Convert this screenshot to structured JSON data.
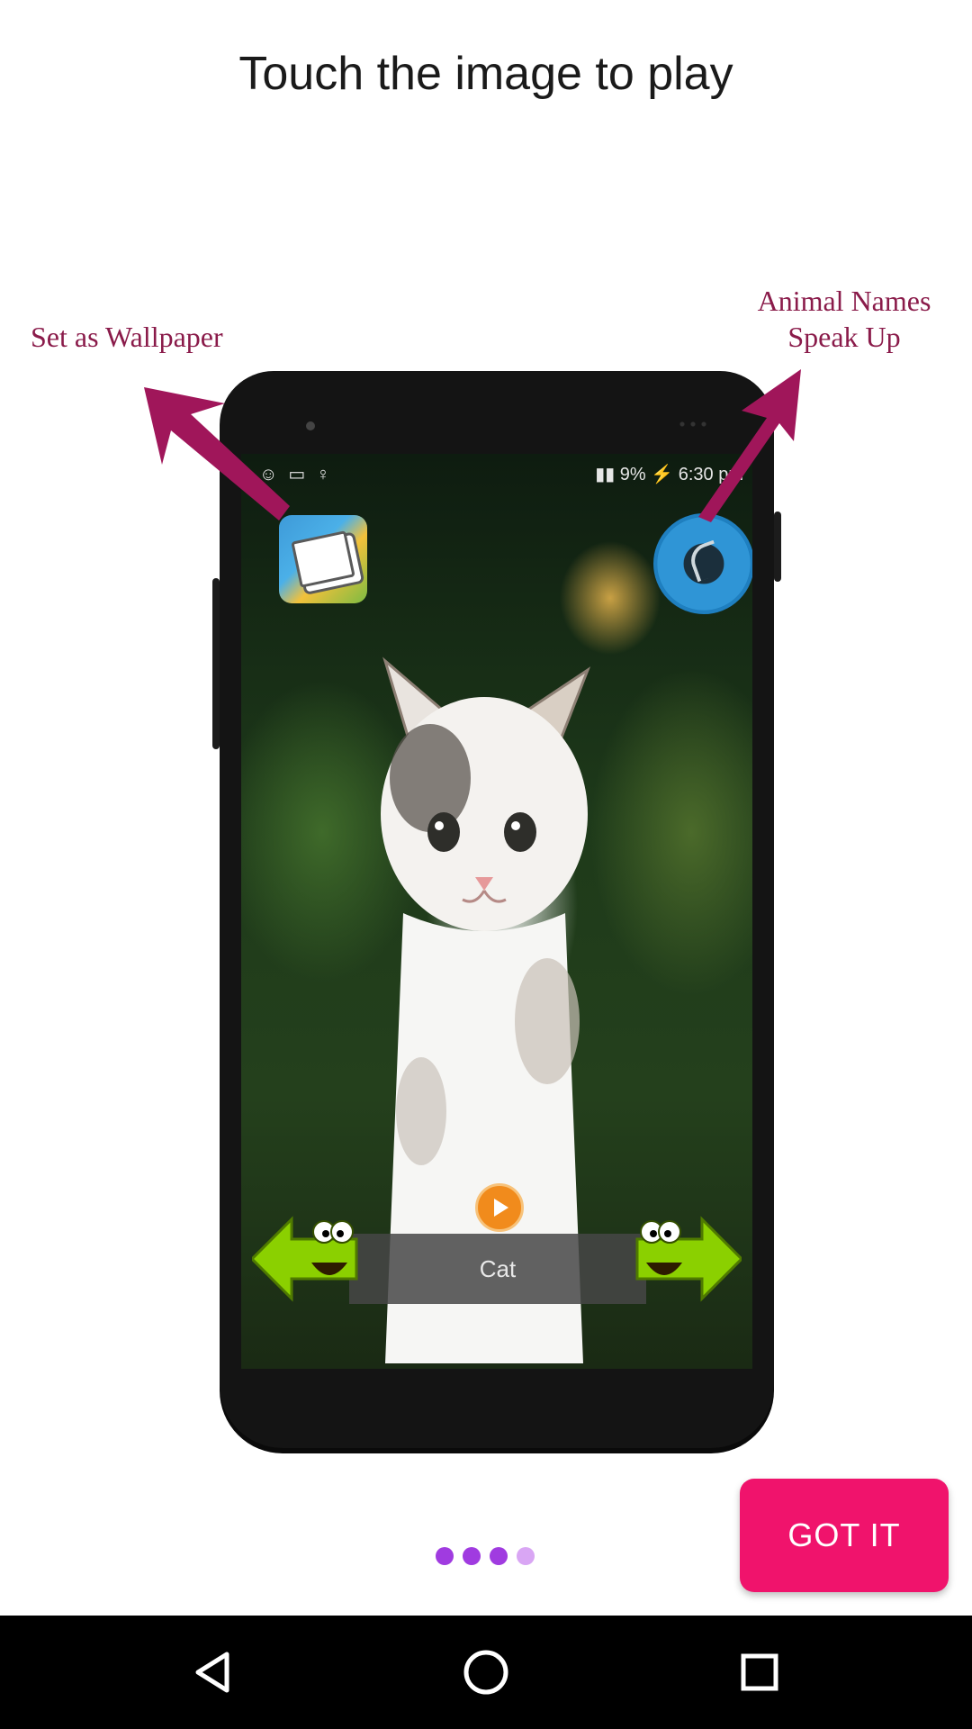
{
  "header": {
    "title": "Touch the image to play"
  },
  "callouts": {
    "left": "Set as Wallpaper",
    "right_line1": "Animal Names",
    "right_line2": "Speak Up"
  },
  "phone_screen": {
    "status_time": "6:30 pm",
    "battery": "9%",
    "animal_name": "Cat"
  },
  "pager": {
    "count": 4,
    "active_index": 3,
    "colors": [
      "#a03be0",
      "#a03be0",
      "#a03be0",
      "#d9a6f4"
    ]
  },
  "actions": {
    "got_it": "GOT IT"
  },
  "colors": {
    "accent": "#f0136c",
    "callout": "#8a1b4a"
  },
  "navbar": {
    "items": [
      "back-icon",
      "home-icon",
      "recents-icon"
    ]
  }
}
